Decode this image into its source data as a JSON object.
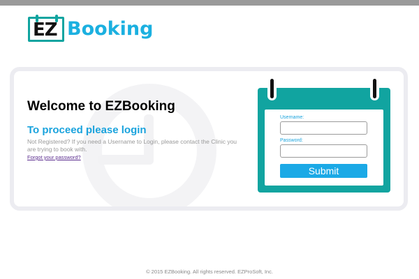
{
  "logo": {
    "ez_text": "EZ",
    "word_text": "Booking"
  },
  "card": {
    "welcome_title": "Welcome to EZBooking",
    "proceed_heading": "To proceed please login",
    "note_text": "Not Registered? If you need a Username to Login, please contact the Clinic you are trying to book with.",
    "forgot_link": "Forgot your password?"
  },
  "login": {
    "username_label": "Username:",
    "username_value": "",
    "password_label": "Password:",
    "password_value": "",
    "submit_label": "Submit"
  },
  "footer": {
    "copyright": "© 2015 EZBooking. All rights reserved. EZProSoft, Inc."
  },
  "colors": {
    "teal": "#11a4a0",
    "brand_blue": "#1aa3dd",
    "submit_blue": "#1ba9e6",
    "link_purple": "#5b2d8e"
  }
}
